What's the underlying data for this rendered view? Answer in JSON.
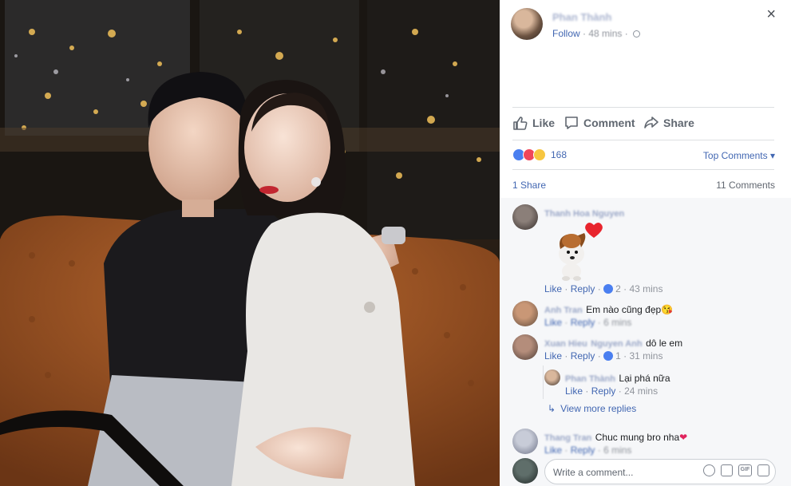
{
  "post": {
    "author": "Phan Thành",
    "follow_label": "Follow",
    "time": "48 mins",
    "close_glyph": "×"
  },
  "actions": {
    "like": "Like",
    "comment": "Comment",
    "share": "Share"
  },
  "stats": {
    "reaction_icons": [
      "like-icon",
      "love-icon",
      "wow-icon"
    ],
    "reaction_count": "168",
    "sort_label": "Top Comments",
    "shares": "1 Share",
    "comments": "11 Comments"
  },
  "comments": [
    {
      "name": "Thanh Hoa Nguyen",
      "text": "",
      "sticker": "puppy-heart-sticker",
      "like": "Like",
      "reply": "Reply",
      "likes": "2",
      "time": "43 mins"
    },
    {
      "name": "Anh Tran",
      "text": "Em nào cũng đẹp",
      "emoji": "😘",
      "like": "Like",
      "reply": "Reply",
      "time": "6 mins"
    },
    {
      "name": "Xuan Hieu",
      "mention": "Nguyen Anh",
      "text": "dô le em",
      "like": "Like",
      "reply": "Reply",
      "likes": "1",
      "time": "31 mins"
    },
    {
      "name": "Phan Thành",
      "text": "Lại phá nữa",
      "like": "Like",
      "reply": "Reply",
      "time": "24 mins",
      "is_reply": true
    },
    {
      "name": "Thang Tran",
      "text": "Chuc mung bro nha",
      "emoji": "❤",
      "like": "Like",
      "reply": "Reply",
      "time": "6 mins"
    }
  ],
  "view_more": "View more replies",
  "composer": {
    "placeholder": "Write a comment...",
    "icons": [
      "emoji-icon",
      "camera-icon",
      "gif-icon",
      "sticker-icon"
    ],
    "gif_label": "GIF"
  },
  "colors": {
    "link_blue": "#4267b2",
    "muted_gray": "#90949c",
    "like_blue": "#4a7ff0",
    "love_red": "#f0465a",
    "wow_yellow": "#f7c640"
  }
}
